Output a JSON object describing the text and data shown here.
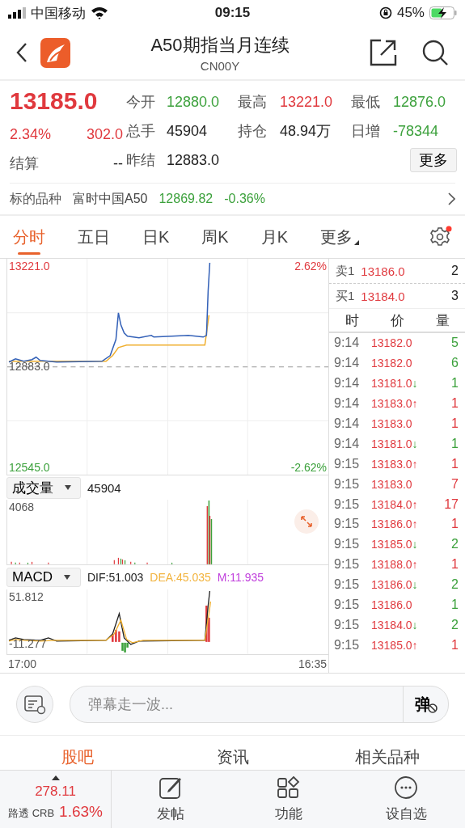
{
  "status_bar": {
    "carrier": "中国移动",
    "time": "09:15",
    "battery": "45%"
  },
  "header": {
    "title": "A50期指当月连续",
    "code": "CN00Y"
  },
  "quote": {
    "price": "13185.0",
    "change_pct": "2.34%",
    "change": "302.0",
    "settle_label": "结算",
    "settle_value": "--",
    "stats": [
      {
        "label": "今开",
        "value": "12880.0",
        "color": "#3ca13c"
      },
      {
        "label": "最高",
        "value": "13221.0",
        "color": "#e0393e"
      },
      {
        "label": "最低",
        "value": "12876.0",
        "color": "#3ca13c"
      },
      {
        "label": "总手",
        "value": "45904",
        "color": "#222222"
      },
      {
        "label": "持仓",
        "value": "48.94万",
        "color": "#222222"
      },
      {
        "label": "日增",
        "value": "-78344",
        "color": "#3ca13c"
      },
      {
        "label": "昨结",
        "value": "12883.0",
        "color": "#222222"
      }
    ],
    "more_button": "更多"
  },
  "underlying": {
    "label": "标的品种",
    "name": "富时中国A50",
    "value": "12869.82",
    "change": "-0.36%",
    "color": "#3ca13c"
  },
  "period_tabs": [
    {
      "label": "分时",
      "selected": true,
      "menu": false
    },
    {
      "label": "五日",
      "selected": false,
      "menu": false
    },
    {
      "label": "日K",
      "selected": false,
      "menu": false
    },
    {
      "label": "周K",
      "selected": false,
      "menu": false
    },
    {
      "label": "月K",
      "selected": false,
      "menu": false
    },
    {
      "label": "更多",
      "selected": false,
      "menu": true
    }
  ],
  "settings_badge": true,
  "chart": {
    "high": "13221.0",
    "high_pct": "2.62%",
    "prev_close": "12883.0",
    "low": "12545.0",
    "low_pct": "-2.62%",
    "volume": {
      "indicator": "成交量",
      "value": "45904",
      "max": "4068"
    },
    "macd": {
      "indicator": "MACD",
      "dif": "DIF:51.003",
      "dea": "DEA:45.035",
      "m": "M:11.935",
      "max": "51.812",
      "min": "-11.277"
    },
    "time_start": "17:00",
    "time_end": "16:35"
  },
  "order_book": [
    {
      "label": "卖1",
      "price": "13186.0",
      "qty": "2"
    },
    {
      "label": "买1",
      "price": "13184.0",
      "qty": "3"
    }
  ],
  "trades_header": [
    "时",
    "价",
    "量"
  ],
  "trades": [
    {
      "time": "9:14",
      "price": "13182.0",
      "qty": "5",
      "color": "#3ca13c"
    },
    {
      "time": "9:14",
      "price": "13182.0",
      "qty": "6",
      "color": "#3ca13c"
    },
    {
      "time": "9:14",
      "price": "13181.0",
      "arrow": "↓",
      "qty": "1",
      "color": "#3ca13c"
    },
    {
      "time": "9:14",
      "price": "13183.0",
      "arrow": "↑",
      "qty": "1",
      "color": "#e0393e"
    },
    {
      "time": "9:14",
      "price": "13183.0",
      "qty": "1",
      "color": "#e0393e"
    },
    {
      "time": "9:14",
      "price": "13181.0",
      "arrow": "↓",
      "qty": "1",
      "color": "#3ca13c"
    },
    {
      "time": "9:15",
      "price": "13183.0",
      "arrow": "↑",
      "qty": "1",
      "color": "#e0393e"
    },
    {
      "time": "9:15",
      "price": "13183.0",
      "qty": "7",
      "color": "#e0393e"
    },
    {
      "time": "9:15",
      "price": "13184.0",
      "arrow": "↑",
      "qty": "17",
      "color": "#e0393e"
    },
    {
      "time": "9:15",
      "price": "13186.0",
      "arrow": "↑",
      "qty": "1",
      "color": "#e0393e"
    },
    {
      "time": "9:15",
      "price": "13185.0",
      "arrow": "↓",
      "qty": "2",
      "color": "#3ca13c"
    },
    {
      "time": "9:15",
      "price": "13188.0",
      "arrow": "↑",
      "qty": "1",
      "color": "#e0393e"
    },
    {
      "time": "9:15",
      "price": "13186.0",
      "arrow": "↓",
      "qty": "2",
      "color": "#3ca13c"
    },
    {
      "time": "9:15",
      "price": "13186.0",
      "qty": "1",
      "color": "#3ca13c"
    },
    {
      "time": "9:15",
      "price": "13184.0",
      "arrow": "↓",
      "qty": "2",
      "color": "#3ca13c"
    },
    {
      "time": "9:15",
      "price": "13185.0",
      "arrow": "↑",
      "qty": "1",
      "color": "#e0393e"
    }
  ],
  "danmaku": {
    "placeholder": "弹幕走一波...",
    "button": "弹"
  },
  "content_tabs": [
    {
      "label": "股吧",
      "selected": true
    },
    {
      "label": "资讯",
      "selected": false
    },
    {
      "label": "相关品种",
      "selected": false
    }
  ],
  "bottom_bar": {
    "ticker": {
      "value": "278.11",
      "name": "路透 CRB",
      "pct": "1.63%",
      "color": "#e0393e"
    },
    "actions": [
      {
        "label": "发帖",
        "kind": "post"
      },
      {
        "label": "功能",
        "kind": "apps"
      },
      {
        "label": "设自选",
        "kind": "more"
      }
    ]
  }
}
